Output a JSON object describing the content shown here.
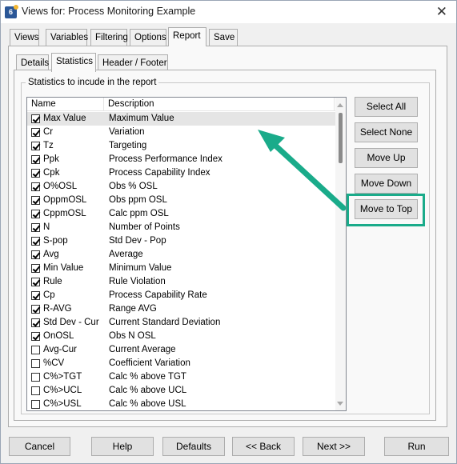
{
  "window": {
    "title": "Views for: Process Monitoring Example",
    "app_icon": "6"
  },
  "outer_tabs": [
    "Views",
    "Variables",
    "Filtering",
    "Options",
    "Report",
    "Save"
  ],
  "inner_tabs": [
    "Details",
    "Statistics",
    "Header / Footer"
  ],
  "group_label": "Statistics to incude in the report",
  "list": {
    "headers": {
      "name": "Name",
      "desc": "Description"
    },
    "rows": [
      {
        "name": "Max Value",
        "desc": "Maximum Value",
        "checked": true
      },
      {
        "name": "Cr",
        "desc": "Variation",
        "checked": true
      },
      {
        "name": "Tz",
        "desc": "Targeting",
        "checked": true
      },
      {
        "name": "Ppk",
        "desc": "Process Performance Index",
        "checked": true
      },
      {
        "name": "Cpk",
        "desc": "Process Capability Index",
        "checked": true
      },
      {
        "name": "O%OSL",
        "desc": "Obs % OSL",
        "checked": true
      },
      {
        "name": "OppmOSL",
        "desc": "Obs ppm OSL",
        "checked": true
      },
      {
        "name": "CppmOSL",
        "desc": "Calc ppm OSL",
        "checked": true
      },
      {
        "name": "N",
        "desc": "Number of Points",
        "checked": true
      },
      {
        "name": "S-pop",
        "desc": "Std Dev - Pop",
        "checked": true
      },
      {
        "name": "Avg",
        "desc": "Average",
        "checked": true
      },
      {
        "name": "Min Value",
        "desc": "Minimum Value",
        "checked": true
      },
      {
        "name": "Rule",
        "desc": "Rule Violation",
        "checked": true
      },
      {
        "name": "Cp",
        "desc": "Process Capability Rate",
        "checked": true
      },
      {
        "name": "R-AVG",
        "desc": "Range AVG",
        "checked": true
      },
      {
        "name": "Std Dev - Cur",
        "desc": "Current Standard Deviation",
        "checked": true
      },
      {
        "name": "OnOSL",
        "desc": "Obs N OSL",
        "checked": true
      },
      {
        "name": "Avg-Cur",
        "desc": "Current Average",
        "checked": false
      },
      {
        "name": "%CV",
        "desc": "Coefficient Variation",
        "checked": false
      },
      {
        "name": "C%>TGT",
        "desc": "Calc % above TGT",
        "checked": false
      },
      {
        "name": "C%>UCL",
        "desc": "Calc % above UCL",
        "checked": false
      },
      {
        "name": "C%>USL",
        "desc": "Calc % above USL",
        "checked": false
      }
    ]
  },
  "side_buttons": {
    "select_all": "Select All",
    "select_none": "Select None",
    "move_up": "Move Up",
    "move_down": "Move Down",
    "move_to_top": "Move to Top"
  },
  "bottom_buttons": {
    "cancel": "Cancel",
    "help": "Help",
    "defaults": "Defaults",
    "back": "<< Back",
    "next": "Next >>",
    "run": "Run"
  },
  "colors": {
    "annotation": "#1aab8a",
    "selected_row": "#e5e5e5"
  }
}
